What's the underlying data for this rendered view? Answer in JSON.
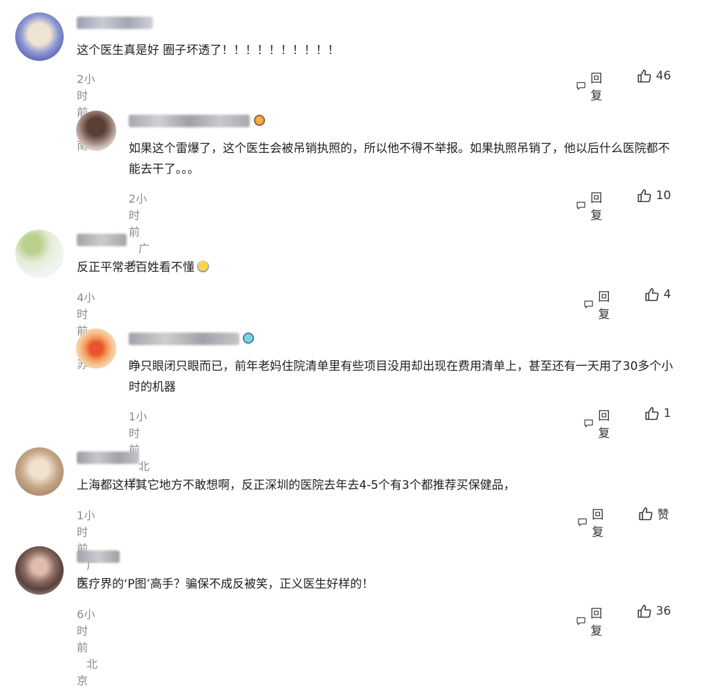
{
  "actions": {
    "reply_label": "回复"
  },
  "comments": [
    {
      "text": "这个医生真是好 圈子坏透了！！！！！！！！！！",
      "time": "2小时前",
      "location": "河南",
      "likes": "46",
      "avatar_colors": [
        "#7a86c8",
        "#e8d6c4"
      ]
    },
    {
      "text": "如果这个雷爆了，这个医生会被吊销执照的，所以他不得不举报。如果执照吊销了，他以后什么医院都不能去干了。。。",
      "time": "2小时前",
      "location": "广东",
      "likes": "10",
      "avatar_colors": [
        "#6b4a3f",
        "#d9cbc2"
      ]
    },
    {
      "text": "反正平常老百姓看不懂",
      "time": "4小时前",
      "location": "江苏",
      "likes": "4",
      "avatar_colors": [
        "#c7d9a8",
        "#eef2ea"
      ]
    },
    {
      "text": "睁只眼闭只眼而已，前年老妈住院清单里有些项目没用却出现在费用清单上，甚至还有一天用了30多个小时的机器",
      "time": "1小时前",
      "location": "北京",
      "likes": "1",
      "avatar_colors": [
        "#e0622e",
        "#f3b88a"
      ]
    },
    {
      "text": "上海都这样其它地方不敢想啊，反正深圳的医院去年去4-5个有3个都推荐买保健品，",
      "time": "1小时前",
      "location": "广东",
      "likes": "赞",
      "avatar_colors": [
        "#c9b08f",
        "#efe3d2"
      ]
    },
    {
      "text": "医疗界的‘P图’高手？骗保不成反被笑，正义医生好样的！",
      "time": "6小时前",
      "location": "北京",
      "likes": "36",
      "avatar_colors": [
        "#6e5450",
        "#d8b8ad"
      ]
    }
  ]
}
